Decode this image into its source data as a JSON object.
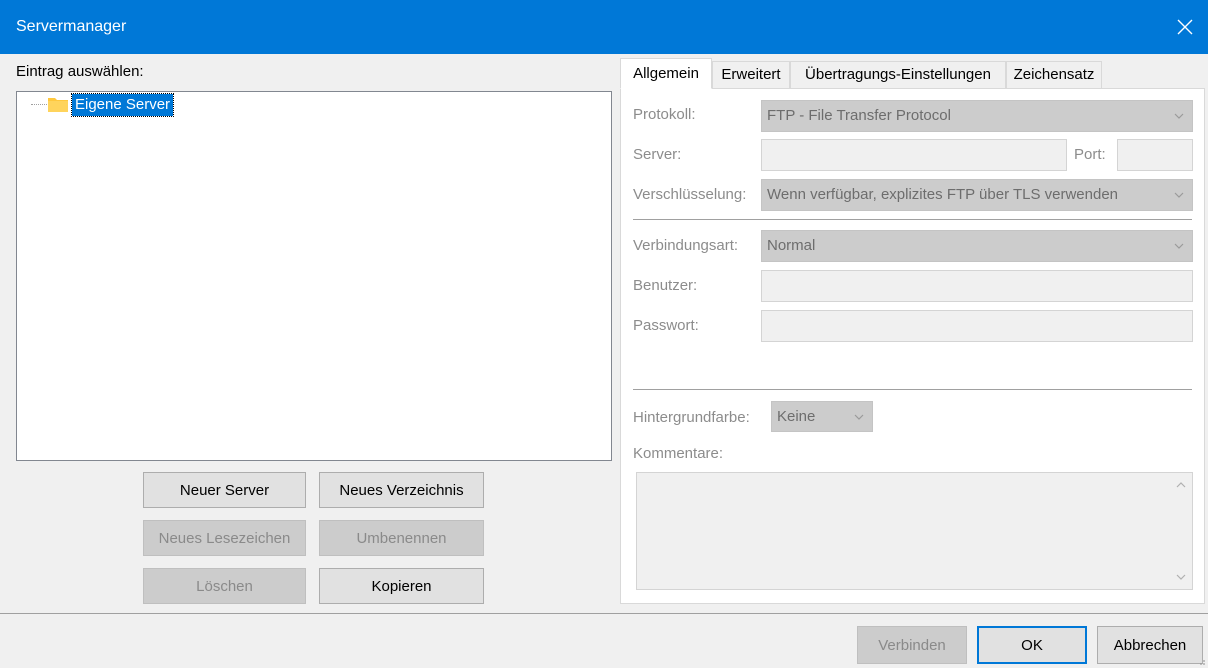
{
  "window": {
    "title": "Servermanager"
  },
  "left": {
    "label": "Eintrag auswählen:",
    "tree": [
      {
        "label": "Eigene Server",
        "selected": true
      }
    ],
    "buttons": {
      "new_server": "Neuer Server",
      "new_folder": "Neues Verzeichnis",
      "new_bookmark": "Neues Lesezeichen",
      "rename": "Umbenennen",
      "delete": "Löschen",
      "copy": "Kopieren"
    }
  },
  "tabs": [
    {
      "label": "Allgemein",
      "active": true
    },
    {
      "label": "Erweitert",
      "active": false
    },
    {
      "label": "Übertragungs-Einstellungen",
      "active": false
    },
    {
      "label": "Zeichensatz",
      "active": false
    }
  ],
  "general": {
    "protocol_label": "Protokoll:",
    "protocol_value": "FTP - File Transfer Protocol",
    "server_label": "Server:",
    "server_value": "",
    "port_label": "Port:",
    "port_value": "",
    "encryption_label": "Verschlüsselung:",
    "encryption_value": "Wenn verfügbar, explizites FTP über TLS verwenden",
    "logon_type_label": "Verbindungsart:",
    "logon_type_value": "Normal",
    "user_label": "Benutzer:",
    "user_value": "",
    "password_label": "Passwort:",
    "password_value": "",
    "bgcolor_label": "Hintergrundfarbe:",
    "bgcolor_value": "Keine",
    "comments_label": "Kommentare:",
    "comments_value": ""
  },
  "footer": {
    "connect": "Verbinden",
    "ok": "OK",
    "cancel": "Abbrechen"
  },
  "colors": {
    "titlebar": "#0078d7",
    "selection": "#0078d7",
    "folder": "#ffc83d"
  },
  "icons": {
    "close": "close-icon",
    "folder": "folder-icon",
    "dropdown": "chevron-down-icon"
  }
}
